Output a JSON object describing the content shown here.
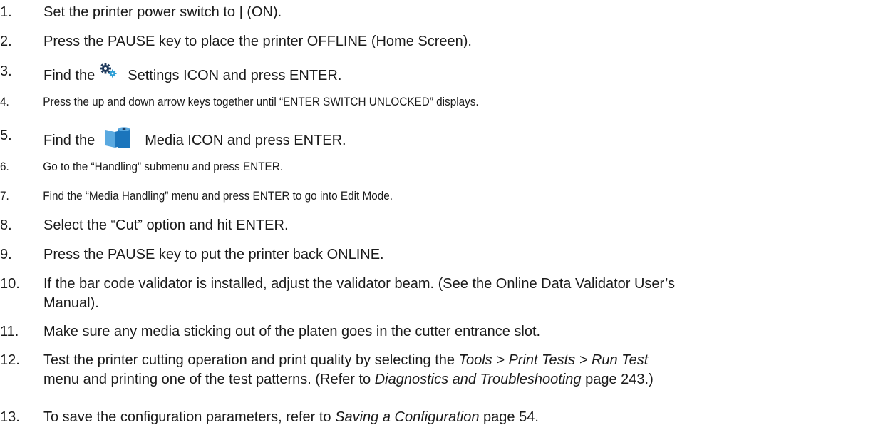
{
  "steps": [
    {
      "num": "1.",
      "text": "Set the printer power switch to | (ON)."
    },
    {
      "num": "2.",
      "text": "Press the PAUSE key to place the printer OFFLINE (Home Screen)."
    },
    {
      "num": "3.",
      "before": "Find the",
      "after": "Settings ICON and press ENTER.",
      "icon": "gear-icon"
    },
    {
      "num": "4.",
      "text": "Press the up and down arrow keys together until “ENTER SWITCH UNLOCKED” displays."
    },
    {
      "num": "5.",
      "before": "Find the",
      "after": "Media ICON and press ENTER.",
      "icon": "media-roll-icon"
    },
    {
      "num": "6.",
      "text": "Go to the “Handling” submenu and press ENTER."
    },
    {
      "num": "7.",
      "text": "Find the “Media Handling” menu and press ENTER to go into Edit Mode."
    },
    {
      "num": "8.",
      "text": "Select the “Cut” option and hit ENTER."
    },
    {
      "num": "9.",
      "text": "Press the PAUSE key to put the printer back ONLINE."
    },
    {
      "num": "10.",
      "line1": "If the bar code validator is installed, adjust the validator beam.   (See the Online Data Validator User’s",
      "line2": "Manual)."
    },
    {
      "num": "11.",
      "text": "Make sure any media sticking out of the platen goes in the cutter entrance  slot."
    },
    {
      "num": "12.",
      "line1_a": "Test the printer cutting operation and print quality by selecting the  ",
      "line1_i": "Tools > Print Tests > Run Test",
      "line2_a": "menu and printing one of the test patterns.  (Refer to ",
      "line2_i": "Diagnostics and Troubleshooting",
      "line2_b": " page 243.)"
    },
    {
      "num": "13.",
      "text_a": "To save the configuration parameters, refer to ",
      "text_i": "Saving a Configuration",
      "text_b": " page 54."
    }
  ],
  "colors": {
    "text": "#1a1a1a",
    "icon_blue": "#1b75bc",
    "icon_light": "#5aa9e0",
    "gear_dark": "#1f3a5c",
    "gear_light": "#2f9fd6"
  }
}
